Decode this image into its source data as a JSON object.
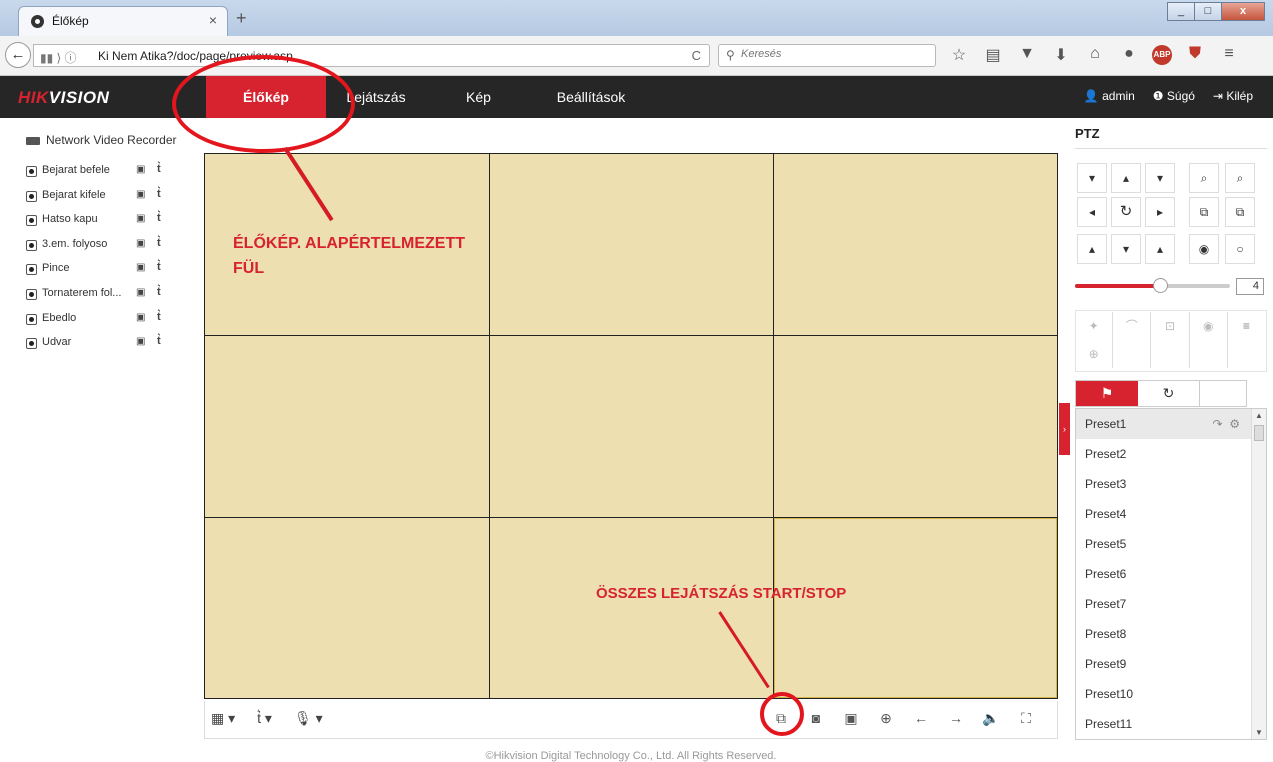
{
  "browser": {
    "tab_title": "Élőkép",
    "tab_close": "×",
    "new_tab": "+",
    "url_info": "▮▮ ⟩ ⓘ",
    "url": "Ki Nem Atika?/doc/page/preview.asp",
    "reload": "C",
    "search_placeholder": "Keresés"
  },
  "header": {
    "logo_red": "HIK",
    "logo_white": "VISION",
    "nav": [
      "Élőkép",
      "Lejátszás",
      "Kép",
      "Beállítások"
    ],
    "user": "admin",
    "help": "Súgó",
    "logout": "Kilép"
  },
  "tree": {
    "root": "Network Video Recorder",
    "cameras": [
      {
        "name": "Bejarat befele"
      },
      {
        "name": "Bejarat kifele"
      },
      {
        "name": "Hatso kapu"
      },
      {
        "name": "3.em. folyoso"
      },
      {
        "name": "Pince"
      },
      {
        "name": "Tornaterem fol..."
      },
      {
        "name": "Ebedlo"
      },
      {
        "name": "Udvar"
      }
    ]
  },
  "annotations": {
    "live_tab_line1": "ÉLŐKÉP. ALAPÉRTELMEZETT",
    "live_tab_line2": "FÜL",
    "start_stop": "ÖSSZES LEJÁTSZÁS START/STOP"
  },
  "ptz": {
    "title": "PTZ",
    "speed": "4",
    "speed_level": 0.55,
    "presets": [
      "Preset1",
      "Preset2",
      "Preset3",
      "Preset4",
      "Preset5",
      "Preset6",
      "Preset7",
      "Preset8",
      "Preset9",
      "Preset10",
      "Preset11"
    ]
  },
  "footer": "©Hikvision Digital Technology Co., Ltd. All Rights Reserved.",
  "colors": {
    "accent": "#d7232f",
    "video_bg": "#eddfb0",
    "header_bg": "#262626"
  }
}
